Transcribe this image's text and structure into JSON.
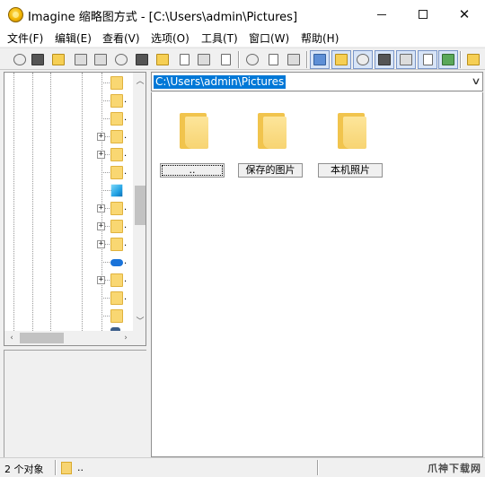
{
  "window": {
    "title": "Imagine 缩略图方式 - [C:\\Users\\admin\\Pictures]"
  },
  "menu": [
    "文件(F)",
    "编辑(E)",
    "查看(V)",
    "选项(O)",
    "工具(T)",
    "窗口(W)",
    "帮助(H)"
  ],
  "toolbar": {
    "buttons": [
      {
        "name": "eye-icon",
        "pressed": false
      },
      {
        "name": "slideshow-icon",
        "pressed": false
      },
      {
        "name": "open-folder-icon",
        "pressed": false
      },
      {
        "name": "save-icon",
        "pressed": false
      },
      {
        "name": "print-icon",
        "pressed": false
      },
      {
        "name": "info-icon",
        "pressed": false
      },
      {
        "name": "camera-icon",
        "pressed": false
      },
      {
        "name": "new-folder-icon",
        "pressed": false
      },
      {
        "name": "rename-icon",
        "pressed": false
      },
      {
        "name": "delete-icon",
        "pressed": false
      },
      {
        "name": "properties-icon",
        "pressed": false
      },
      {
        "name": "cut-icon",
        "pressed": false
      },
      {
        "name": "copy-icon",
        "pressed": false
      },
      {
        "name": "paste-icon",
        "pressed": false
      },
      {
        "name": "address-bar-toggle-icon",
        "pressed": true
      },
      {
        "name": "folder-tree-toggle-icon",
        "pressed": true
      },
      {
        "name": "preview-toggle-icon",
        "pressed": true
      },
      {
        "name": "info-panel-toggle-icon",
        "pressed": true
      },
      {
        "name": "thumbnail-view-icon",
        "pressed": true
      },
      {
        "name": "details-view-icon",
        "pressed": true
      },
      {
        "name": "large-preview-icon",
        "pressed": true
      },
      {
        "name": "parent-folder-icon",
        "pressed": false
      }
    ]
  },
  "tree": {
    "nodes": [
      {
        "icon": "folder-icon",
        "expander": "",
        "label": ""
      },
      {
        "icon": "folder-icon",
        "expander": "",
        "label": "."
      },
      {
        "icon": "folder-icon",
        "expander": "",
        "label": "."
      },
      {
        "icon": "folder-icon",
        "expander": "+",
        "label": "."
      },
      {
        "icon": "folder-icon",
        "expander": "+",
        "label": "."
      },
      {
        "icon": "folder-icon",
        "expander": "",
        "label": "."
      },
      {
        "icon": "cube-icon",
        "expander": "",
        "label": ""
      },
      {
        "icon": "folder-icon",
        "expander": "+",
        "label": "."
      },
      {
        "icon": "folder-icon",
        "expander": "+",
        "label": "."
      },
      {
        "icon": "folder-icon",
        "expander": "+",
        "label": "."
      },
      {
        "icon": "cloud-icon",
        "expander": "",
        "label": "."
      },
      {
        "icon": "folder-icon",
        "expander": "+",
        "label": "."
      },
      {
        "icon": "folder-icon",
        "expander": "",
        "label": "."
      },
      {
        "icon": "folder-icon",
        "expander": "",
        "label": ""
      },
      {
        "icon": "network-icon",
        "expander": "",
        "label": ""
      }
    ]
  },
  "path_bar": {
    "value": "C:\\Users\\admin\\Pictures"
  },
  "thumbnails": [
    {
      "caption": "..",
      "selected": true
    },
    {
      "caption": "保存的图片",
      "selected": false
    },
    {
      "caption": "本机照片",
      "selected": false
    }
  ],
  "status": {
    "count": "2 个对象",
    "current": "..",
    "watermark": "爪神下载网"
  }
}
